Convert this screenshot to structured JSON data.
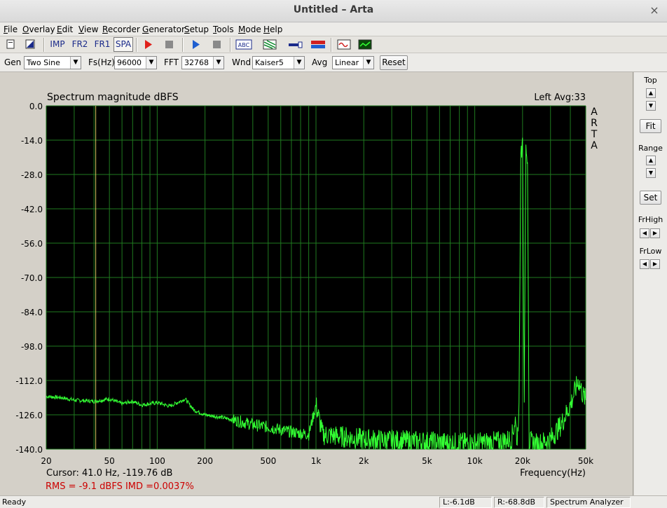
{
  "window": {
    "title": "Untitled – Arta",
    "close_glyph": "×"
  },
  "menu": [
    "File",
    "Overlay",
    "Edit",
    "View",
    "Recorder",
    "Generator",
    "Setup",
    "Tools",
    "Mode",
    "Help"
  ],
  "toolbar": {
    "imp": "IMP",
    "fr2": "FR2",
    "fr1": "FR1",
    "spa": "SPA",
    "abc": "ABC"
  },
  "controls": {
    "gen_label": "Gen",
    "gen_value": "Two Sine",
    "fs_label": "Fs(Hz)",
    "fs_value": "96000",
    "fft_label": "FFT",
    "fft_value": "32768",
    "wnd_label": "Wnd",
    "wnd_value": "Kaiser5",
    "avg_label": "Avg",
    "avg_value": "Linear",
    "reset_label": "Reset"
  },
  "side_panel": {
    "top_label": "Top",
    "fit_label": "Fit",
    "range_label": "Range",
    "set_label": "Set",
    "frhigh_label": "FrHigh",
    "frlow_label": "FrLow",
    "up_glyph": "▲",
    "down_glyph": "▼",
    "left_glyph": "◀",
    "right_glyph": "▶"
  },
  "plot": {
    "brand_letters": [
      "A",
      "R",
      "T",
      "A"
    ],
    "cursor_text": "Cursor:    41.0 Hz, -119.76 dB",
    "rms_text": "RMS =   -9.1 dBFS   IMD =0.0037%",
    "cursor_freq_hz": 41.0,
    "colors": {
      "background": "#000000",
      "grid": "#1f7a1f",
      "trace": "#33ff33",
      "cursor": "#d8c860",
      "stats": "#cc0000"
    }
  },
  "chart_data": {
    "type": "line",
    "title": "Spectrum magnitude dBFS",
    "channel_label": "Left  Avg:33",
    "xlabel": "Frequency(Hz)",
    "ylabel": "",
    "x_scale": "log",
    "xlim": [
      20,
      50000
    ],
    "ylim": [
      -140,
      0
    ],
    "x_ticks": [
      20,
      50,
      100,
      200,
      500,
      1000,
      2000,
      5000,
      10000,
      20000,
      50000
    ],
    "x_tick_labels": [
      "20",
      "50",
      "100",
      "200",
      "500",
      "1k",
      "2k",
      "5k",
      "10k",
      "20k",
      "50k"
    ],
    "y_ticks": [
      0,
      -14,
      -28,
      -42,
      -56,
      -70,
      -84,
      -98,
      -112,
      -126,
      -140
    ],
    "y_tick_labels": [
      "0.0",
      "-14.0",
      "-28.0",
      "-42.0",
      "-56.0",
      "-70.0",
      "-84.0",
      "-98.0",
      "-112.0",
      "-126.0",
      "-140.0"
    ],
    "grid": true,
    "series": [
      {
        "x": [
          20,
          25,
          30,
          40,
          50,
          60,
          70,
          80,
          100,
          120,
          150,
          170,
          200,
          250,
          300,
          400,
          500,
          700,
          900,
          1000,
          1100,
          1500,
          2000,
          3000,
          5000,
          7000,
          10000,
          14000,
          17000,
          18000,
          18500,
          19000,
          19500,
          20000,
          20500,
          21000,
          21500,
          22000,
          25000,
          30000,
          35000,
          40000,
          45000,
          48000,
          50000
        ],
        "y": [
          -118.5,
          -119,
          -120,
          -120.5,
          -119.5,
          -121.5,
          -120.5,
          -122,
          -121,
          -122.5,
          -119.5,
          -124,
          -126,
          -127,
          -128,
          -130,
          -131,
          -133,
          -134,
          -122,
          -134,
          -135,
          -136,
          -136.5,
          -137,
          -137.5,
          -137.5,
          -137,
          -136,
          -128,
          -137,
          -121,
          -23,
          -13,
          -121,
          -13,
          -23,
          -137,
          -138,
          -136,
          -130,
          -122,
          -112,
          -118,
          -120
        ]
      }
    ]
  }
}
